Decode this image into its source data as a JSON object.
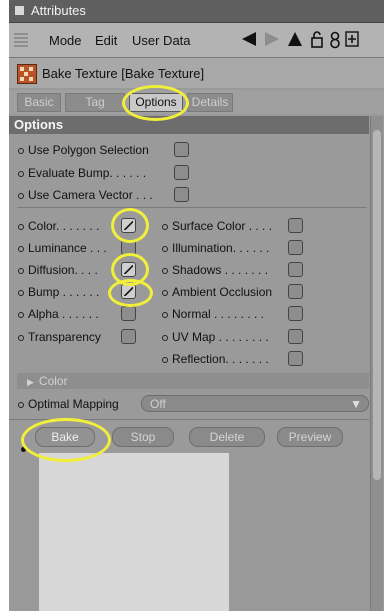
{
  "window": {
    "title": "Attributes"
  },
  "menubar": {
    "items": [
      "Mode",
      "Edit",
      "User Data"
    ],
    "icons": [
      "arrow-left-icon",
      "arrow-right-icon",
      "arrow-up-icon",
      "lock-icon",
      "eight-icon",
      "add-icon"
    ]
  },
  "object": {
    "title": "Bake Texture [Bake Texture]",
    "icon": "bake-texture-icon"
  },
  "tabs": [
    {
      "label": "Basic"
    },
    {
      "label": "Tag"
    },
    {
      "label": "Options",
      "active": true
    },
    {
      "label": "Details"
    }
  ],
  "section": {
    "title": "Options"
  },
  "options_top": [
    {
      "label": "Use Polygon Selection",
      "checked": false
    },
    {
      "label": "Evaluate Bump. . . . . .",
      "checked": false
    },
    {
      "label": "Use Camera Vector . . .",
      "checked": false
    }
  ],
  "channels_left": [
    {
      "label": "Color. . . . . . .",
      "checked": true
    },
    {
      "label": "Luminance . . .",
      "checked": false
    },
    {
      "label": "Diffusion. . . .",
      "checked": true
    },
    {
      "label": "Bump . . . . . .",
      "checked": true
    },
    {
      "label": "Alpha . . . . . .",
      "checked": false
    },
    {
      "label": "Transparency",
      "checked": false
    }
  ],
  "channels_right": [
    {
      "label": "Surface Color . . . .",
      "checked": false
    },
    {
      "label": "Illumination. . . . . .",
      "checked": false
    },
    {
      "label": "Shadows . . . . . . .",
      "checked": false
    },
    {
      "label": "Ambient Occlusion",
      "checked": false
    },
    {
      "label": "Normal . . . . . . . .",
      "checked": false
    },
    {
      "label": "UV Map . . . . . . . .",
      "checked": false
    },
    {
      "label": "Reflection. . . . . . .",
      "checked": false
    }
  ],
  "color_group": {
    "label": "Color"
  },
  "mapping": {
    "label": "Optimal Mapping",
    "value": "Off"
  },
  "buttons": {
    "bake": "Bake",
    "stop": "Stop",
    "delete": "Delete",
    "preview": "Preview"
  },
  "colors": {
    "highlight": "#f1ef3a",
    "panel": "#9a9a9a",
    "titlebar": "#5f5f5f",
    "header": "#6d6d6d"
  }
}
